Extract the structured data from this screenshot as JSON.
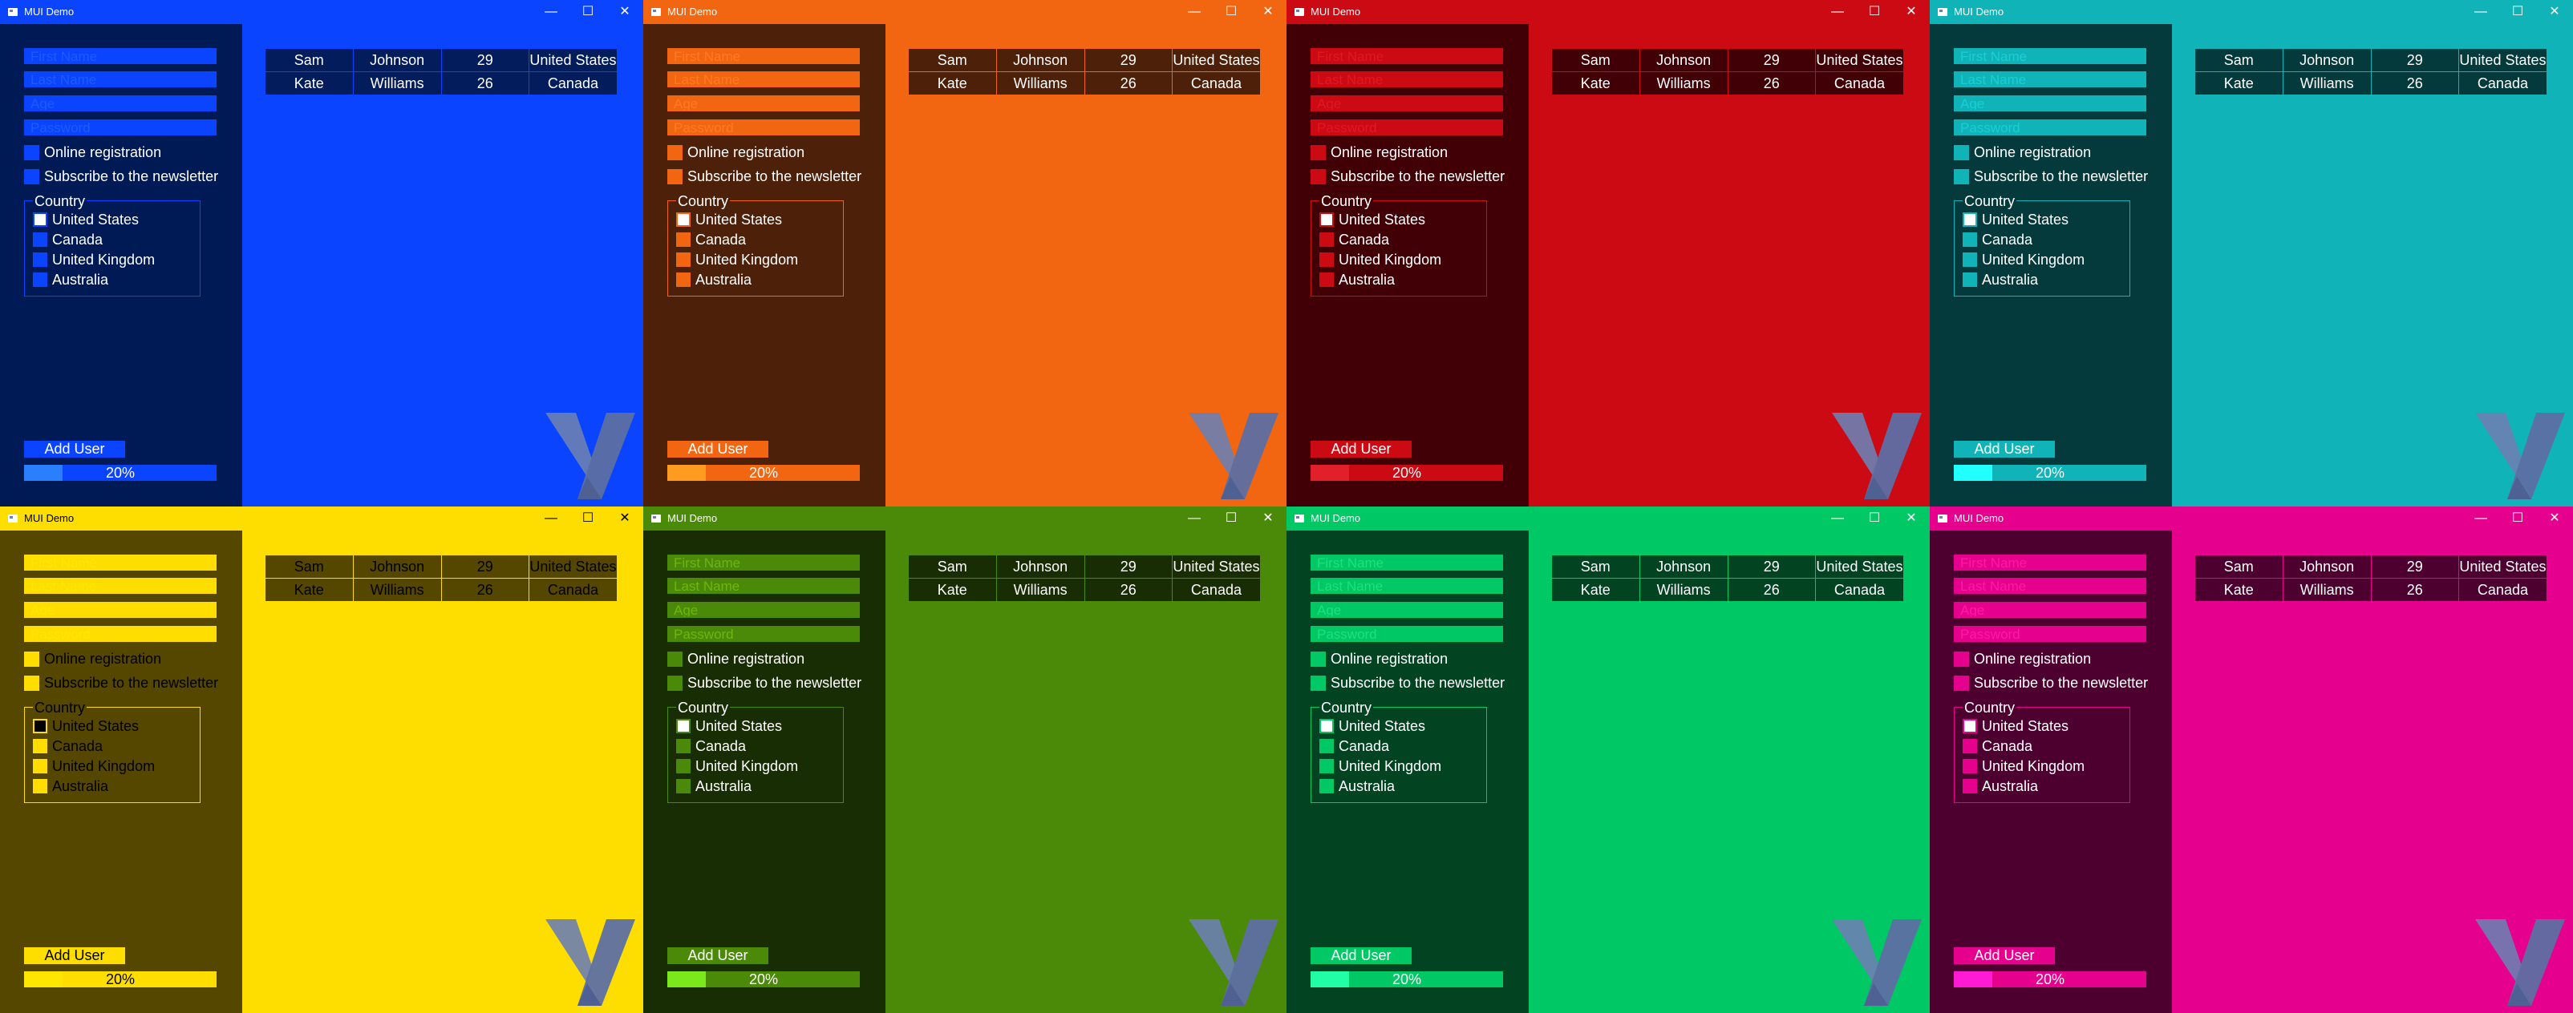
{
  "app": {
    "title": "MUI Demo",
    "minimize_glyph": "—",
    "maximize_glyph": "☐",
    "close_glyph": "✕"
  },
  "form": {
    "first_name_placeholder": "First Name",
    "last_name_placeholder": "Last Name",
    "age_placeholder": "Age",
    "password_placeholder": "Password",
    "online_registration": "Online registration",
    "subscribe_newsletter": "Subscribe to the newsletter",
    "country_group_label": "Country",
    "countries": [
      "United States",
      "Canada",
      "United Kingdom",
      "Australia"
    ],
    "selected_country": "United States",
    "add_user": "Add User",
    "progress_text": "20%",
    "progress_value": 0.2
  },
  "table": {
    "rows": [
      [
        "Sam",
        "Johnson",
        "29",
        "United States"
      ],
      [
        "Kate",
        "Williams",
        "26",
        "Canada"
      ]
    ]
  },
  "logo_icon": "v-logo-icon",
  "themes": [
    {
      "name": "blue",
      "accent": "#0a44ff",
      "panel": "#001a55",
      "row": "#021c5c",
      "field_text": "#1f5cff",
      "radio_selected": "#ffffff",
      "progress_fill": "#2a7fff",
      "progress_track": "#0a44ff",
      "text": "#ffffff"
    },
    {
      "name": "orange",
      "accent": "#f26511",
      "panel": "#4d2009",
      "row": "#4d2009",
      "field_text": "#ff7a24",
      "radio_selected": "#ffffff",
      "progress_fill": "#ff9b1e",
      "progress_track": "#f26511",
      "text": "#ffffff"
    },
    {
      "name": "red",
      "accent": "#cc0a14",
      "panel": "#400006",
      "row": "#400006",
      "field_text": "#e01822",
      "radio_selected": "#ffffff",
      "progress_fill": "#e2202a",
      "progress_track": "#cc0a14",
      "text": "#ffffff"
    },
    {
      "name": "teal",
      "accent": "#10b3b8",
      "panel": "#053a3c",
      "row": "#053a3c",
      "field_text": "#19cfd4",
      "radio_selected": "#ffffff",
      "progress_fill": "#21ffff",
      "progress_track": "#10b3b8",
      "text": "#ffffff"
    },
    {
      "name": "yellow",
      "accent": "#fedd00",
      "panel": "#554600",
      "row": "#554600",
      "field_text": "#ffe600",
      "radio_selected": "#000000",
      "progress_fill": "#ffe600",
      "progress_track": "#fedd00",
      "text": "#000000"
    },
    {
      "name": "green",
      "accent": "#4b8a09",
      "panel": "#182d03",
      "row": "#182d03",
      "field_text": "#6cb60f",
      "radio_selected": "#ffffff",
      "progress_fill": "#7ae81a",
      "progress_track": "#4b8a09",
      "text": "#ffffff"
    },
    {
      "name": "emerald",
      "accent": "#00c864",
      "panel": "#024321",
      "row": "#024321",
      "field_text": "#1fe07c",
      "radio_selected": "#ffffff",
      "progress_fill": "#21ffa6",
      "progress_track": "#00c864",
      "text": "#ffffff"
    },
    {
      "name": "magenta",
      "accent": "#e6008e",
      "panel": "#4d002f",
      "row": "#4d002f",
      "field_text": "#ff1aa4",
      "radio_selected": "#ffffff",
      "progress_fill": "#ff1ad6",
      "progress_track": "#e6008e",
      "text": "#ffffff"
    }
  ]
}
